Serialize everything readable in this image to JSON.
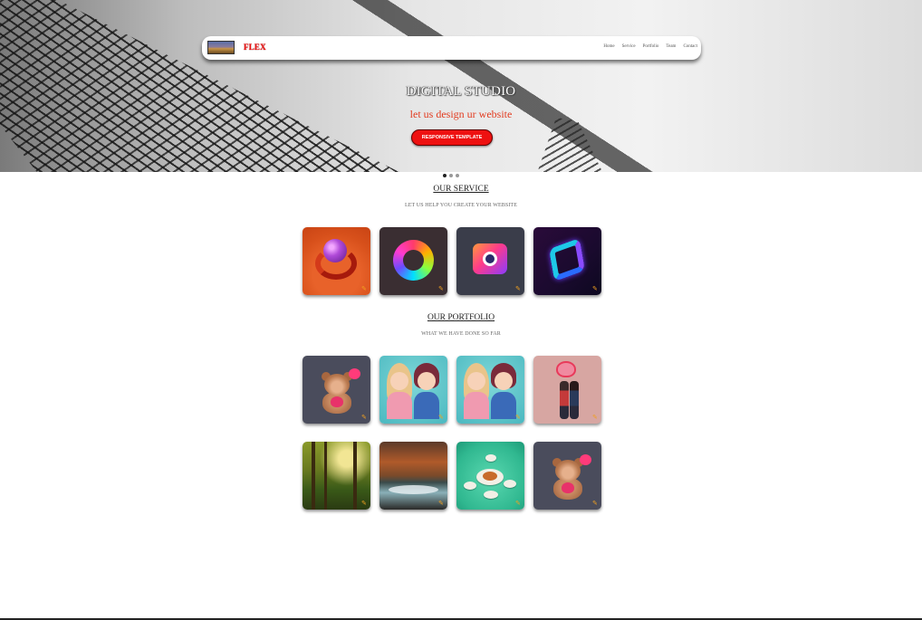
{
  "nav": {
    "brand": "FLEX",
    "links": [
      "Home",
      "Service",
      "Portfolio",
      "Team",
      "Contact"
    ]
  },
  "hero": {
    "title": "DIGITAL STUDIO",
    "subtitle": "let us design ur website",
    "button_label": "RESPONSIVE TEMPLATE",
    "slides": 3,
    "active_slide": 1
  },
  "service": {
    "title": "OUR SERVICE",
    "subtitle": "LET US HELP YOU CREATE YOUR WEBSITE",
    "items": [
      "orange-sphere-logo",
      "rainbow-ring-logo",
      "gradient-play-logo",
      "neon-hexagon-logo"
    ]
  },
  "portfolio": {
    "title": "OUR PORTFOLIO",
    "subtitle": "WHAT WE HAVE DONE SO FAR",
    "items": [
      "teddy-bear",
      "cartoon-kids",
      "cartoon-kids",
      "kissing-couple",
      "sunlit-forest",
      "forest-river",
      "food-platter",
      "teddy-bear"
    ]
  },
  "colors": {
    "brand_red": "#ee1111",
    "subtitle_red": "#e23b1f",
    "edit_icon": "#f0a020"
  },
  "icons": {
    "card_edit": "pencil-icon"
  }
}
